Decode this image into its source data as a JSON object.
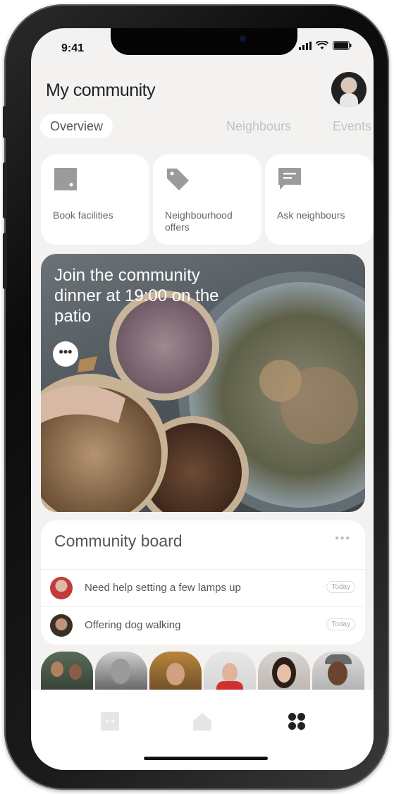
{
  "status_bar": {
    "time": "9:41"
  },
  "header": {
    "title": "My community"
  },
  "tabs": [
    {
      "label": "Overview",
      "active": true
    },
    {
      "label": "Neighbours",
      "active": false
    },
    {
      "label": "Events",
      "active": false
    }
  ],
  "quick_actions": [
    {
      "label": "Book facilities",
      "icon": "door-icon"
    },
    {
      "label": "Neighbourhood offers",
      "icon": "tag-icon"
    },
    {
      "label": "Ask neighbours",
      "icon": "chat-icon"
    }
  ],
  "hero": {
    "text": "Join the community dinner at 19:00 on the patio",
    "more_icon": "more-dots-icon"
  },
  "community_board": {
    "title": "Community board",
    "more_icon": "more-dots-icon",
    "posts": [
      {
        "text": "Need help setting a few lamps up",
        "badge": "Today"
      },
      {
        "text": "Offering dog walking",
        "badge": "Today"
      }
    ]
  },
  "bottom_nav": [
    {
      "icon": "door-icon"
    },
    {
      "icon": "home-icon"
    },
    {
      "icon": "grid-icon"
    }
  ],
  "colors": {
    "screen_bg": "#f3f2f0",
    "card_bg": "#ffffff",
    "icon_gray": "#9b9b9b",
    "text_dark": "#222222",
    "tab_inactive": "#c3c3c3"
  }
}
